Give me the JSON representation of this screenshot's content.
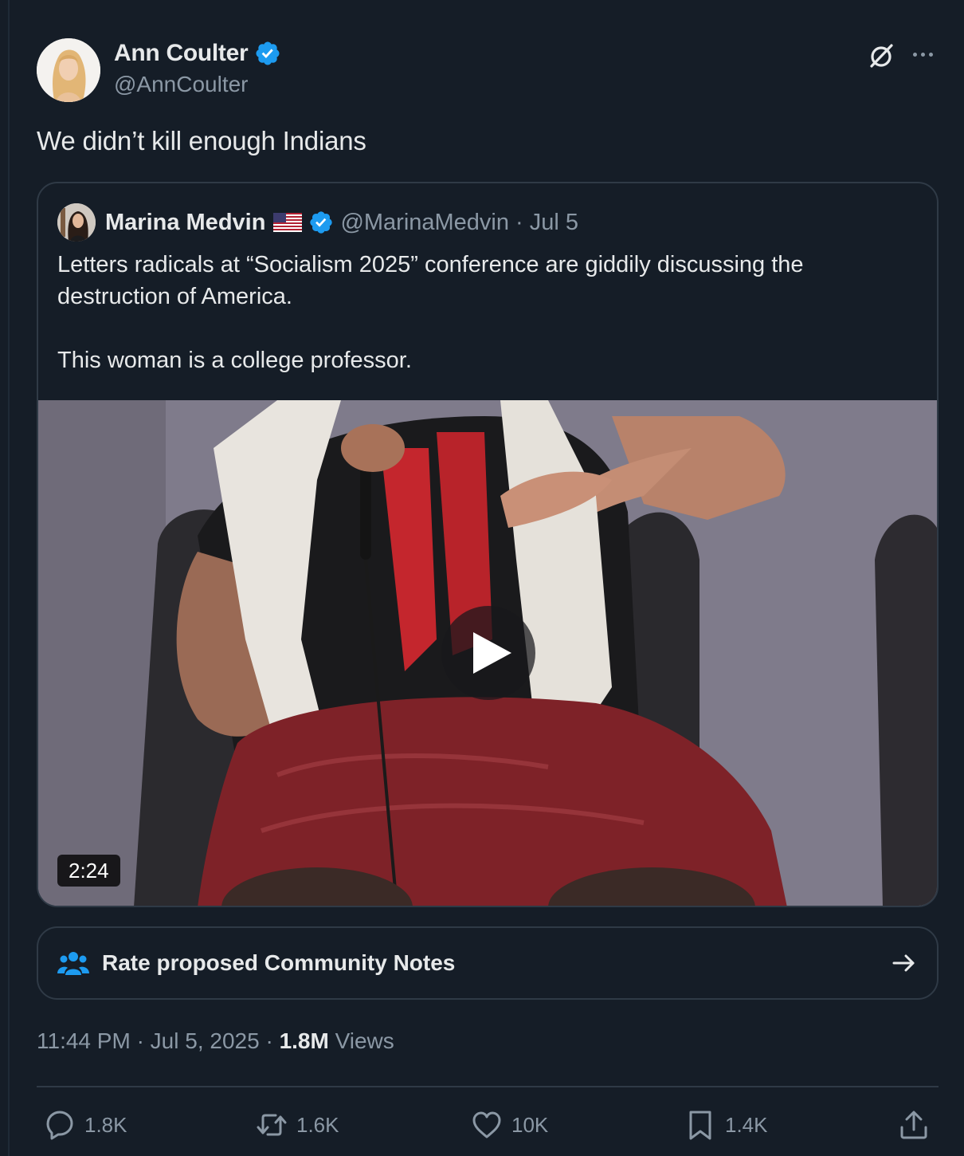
{
  "author": {
    "display_name": "Ann Coulter",
    "handle": "@AnnCoulter",
    "verified": true
  },
  "tweet": {
    "text": "We didn’t kill enough Indians"
  },
  "quote": {
    "display_name": "Marina Medvin",
    "handle": "@MarinaMedvin",
    "separator": "·",
    "date": "Jul 5",
    "verified": true,
    "text_paragraphs": [
      "Letters radicals at “Socialism 2025” conference are giddily discussing the destruction of America.",
      "This woman is a college professor."
    ],
    "video": {
      "duration": "2:24"
    }
  },
  "community_notes": {
    "label": "Rate proposed Community Notes"
  },
  "meta": {
    "time": "11:44 PM",
    "sep1": "·",
    "date": "Jul 5, 2025",
    "sep2": "·",
    "views_count": "1.8M",
    "views_label": "Views"
  },
  "actions": {
    "replies": "1.8K",
    "reposts": "1.6K",
    "likes": "10K",
    "bookmarks": "1.4K"
  },
  "icons": [
    "verified-badge-icon",
    "grok-icon",
    "more-icon",
    "us-flag-icon",
    "play-icon",
    "community-notes-icon",
    "arrow-right-icon",
    "reply-icon",
    "repost-icon",
    "like-icon",
    "bookmark-icon",
    "share-icon"
  ],
  "colors": {
    "background": "#151d27",
    "text_primary": "#e7e9ea",
    "text_secondary": "#8b98a5",
    "border": "#2f3a46",
    "verified_blue": "#1d9bf0"
  }
}
